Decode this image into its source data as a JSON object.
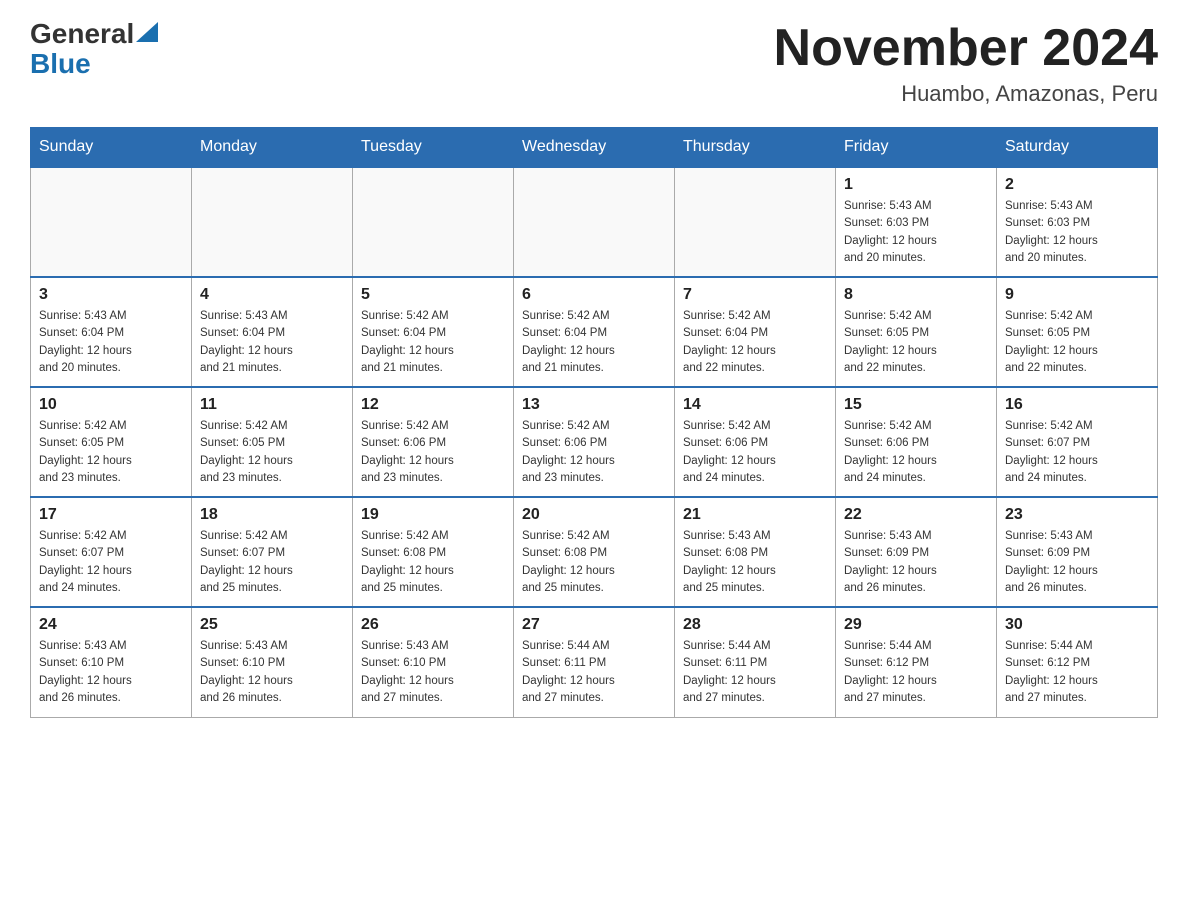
{
  "header": {
    "logo_general": "General",
    "logo_blue": "Blue",
    "month_title": "November 2024",
    "location": "Huambo, Amazonas, Peru"
  },
  "days_of_week": [
    "Sunday",
    "Monday",
    "Tuesday",
    "Wednesday",
    "Thursday",
    "Friday",
    "Saturday"
  ],
  "weeks": [
    [
      {
        "day": "",
        "info": ""
      },
      {
        "day": "",
        "info": ""
      },
      {
        "day": "",
        "info": ""
      },
      {
        "day": "",
        "info": ""
      },
      {
        "day": "",
        "info": ""
      },
      {
        "day": "1",
        "info": "Sunrise: 5:43 AM\nSunset: 6:03 PM\nDaylight: 12 hours\nand 20 minutes."
      },
      {
        "day": "2",
        "info": "Sunrise: 5:43 AM\nSunset: 6:03 PM\nDaylight: 12 hours\nand 20 minutes."
      }
    ],
    [
      {
        "day": "3",
        "info": "Sunrise: 5:43 AM\nSunset: 6:04 PM\nDaylight: 12 hours\nand 20 minutes."
      },
      {
        "day": "4",
        "info": "Sunrise: 5:43 AM\nSunset: 6:04 PM\nDaylight: 12 hours\nand 21 minutes."
      },
      {
        "day": "5",
        "info": "Sunrise: 5:42 AM\nSunset: 6:04 PM\nDaylight: 12 hours\nand 21 minutes."
      },
      {
        "day": "6",
        "info": "Sunrise: 5:42 AM\nSunset: 6:04 PM\nDaylight: 12 hours\nand 21 minutes."
      },
      {
        "day": "7",
        "info": "Sunrise: 5:42 AM\nSunset: 6:04 PM\nDaylight: 12 hours\nand 22 minutes."
      },
      {
        "day": "8",
        "info": "Sunrise: 5:42 AM\nSunset: 6:05 PM\nDaylight: 12 hours\nand 22 minutes."
      },
      {
        "day": "9",
        "info": "Sunrise: 5:42 AM\nSunset: 6:05 PM\nDaylight: 12 hours\nand 22 minutes."
      }
    ],
    [
      {
        "day": "10",
        "info": "Sunrise: 5:42 AM\nSunset: 6:05 PM\nDaylight: 12 hours\nand 23 minutes."
      },
      {
        "day": "11",
        "info": "Sunrise: 5:42 AM\nSunset: 6:05 PM\nDaylight: 12 hours\nand 23 minutes."
      },
      {
        "day": "12",
        "info": "Sunrise: 5:42 AM\nSunset: 6:06 PM\nDaylight: 12 hours\nand 23 minutes."
      },
      {
        "day": "13",
        "info": "Sunrise: 5:42 AM\nSunset: 6:06 PM\nDaylight: 12 hours\nand 23 minutes."
      },
      {
        "day": "14",
        "info": "Sunrise: 5:42 AM\nSunset: 6:06 PM\nDaylight: 12 hours\nand 24 minutes."
      },
      {
        "day": "15",
        "info": "Sunrise: 5:42 AM\nSunset: 6:06 PM\nDaylight: 12 hours\nand 24 minutes."
      },
      {
        "day": "16",
        "info": "Sunrise: 5:42 AM\nSunset: 6:07 PM\nDaylight: 12 hours\nand 24 minutes."
      }
    ],
    [
      {
        "day": "17",
        "info": "Sunrise: 5:42 AM\nSunset: 6:07 PM\nDaylight: 12 hours\nand 24 minutes."
      },
      {
        "day": "18",
        "info": "Sunrise: 5:42 AM\nSunset: 6:07 PM\nDaylight: 12 hours\nand 25 minutes."
      },
      {
        "day": "19",
        "info": "Sunrise: 5:42 AM\nSunset: 6:08 PM\nDaylight: 12 hours\nand 25 minutes."
      },
      {
        "day": "20",
        "info": "Sunrise: 5:42 AM\nSunset: 6:08 PM\nDaylight: 12 hours\nand 25 minutes."
      },
      {
        "day": "21",
        "info": "Sunrise: 5:43 AM\nSunset: 6:08 PM\nDaylight: 12 hours\nand 25 minutes."
      },
      {
        "day": "22",
        "info": "Sunrise: 5:43 AM\nSunset: 6:09 PM\nDaylight: 12 hours\nand 26 minutes."
      },
      {
        "day": "23",
        "info": "Sunrise: 5:43 AM\nSunset: 6:09 PM\nDaylight: 12 hours\nand 26 minutes."
      }
    ],
    [
      {
        "day": "24",
        "info": "Sunrise: 5:43 AM\nSunset: 6:10 PM\nDaylight: 12 hours\nand 26 minutes."
      },
      {
        "day": "25",
        "info": "Sunrise: 5:43 AM\nSunset: 6:10 PM\nDaylight: 12 hours\nand 26 minutes."
      },
      {
        "day": "26",
        "info": "Sunrise: 5:43 AM\nSunset: 6:10 PM\nDaylight: 12 hours\nand 27 minutes."
      },
      {
        "day": "27",
        "info": "Sunrise: 5:44 AM\nSunset: 6:11 PM\nDaylight: 12 hours\nand 27 minutes."
      },
      {
        "day": "28",
        "info": "Sunrise: 5:44 AM\nSunset: 6:11 PM\nDaylight: 12 hours\nand 27 minutes."
      },
      {
        "day": "29",
        "info": "Sunrise: 5:44 AM\nSunset: 6:12 PM\nDaylight: 12 hours\nand 27 minutes."
      },
      {
        "day": "30",
        "info": "Sunrise: 5:44 AM\nSunset: 6:12 PM\nDaylight: 12 hours\nand 27 minutes."
      }
    ]
  ]
}
